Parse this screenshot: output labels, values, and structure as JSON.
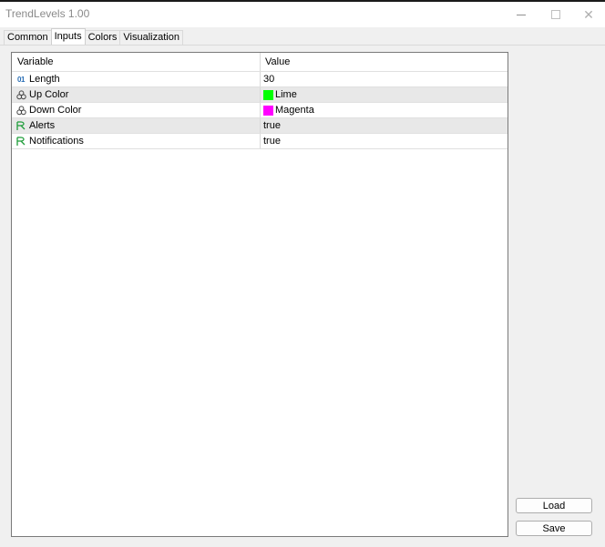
{
  "window": {
    "title": "TrendLevels 1.00"
  },
  "tabs": [
    {
      "label": "Common",
      "active": false
    },
    {
      "label": "Inputs",
      "active": true
    },
    {
      "label": "Colors",
      "active": false
    },
    {
      "label": "Visualization",
      "active": false
    }
  ],
  "grid": {
    "columns": [
      "Variable",
      "Value"
    ],
    "rows": [
      {
        "icon": "integer-icon",
        "icon_text": "01",
        "variable": "Length",
        "value": "30"
      },
      {
        "icon": "color-icon",
        "variable": "Up Color",
        "value": "Lime",
        "swatch": "#00ff00"
      },
      {
        "icon": "color-icon",
        "variable": "Down Color",
        "value": "Magenta",
        "swatch": "#ff00ff"
      },
      {
        "icon": "boolean-icon",
        "variable": "Alerts",
        "value": "true"
      },
      {
        "icon": "boolean-icon",
        "variable": "Notifications",
        "value": "true"
      }
    ]
  },
  "buttons": {
    "load_label": "Load",
    "save_label": "Save"
  },
  "colors": {
    "lime": "#00ff00",
    "magenta": "#ff00ff",
    "integer_icon": "#2a6fb5",
    "boolean_icon": "#1f9d3a"
  }
}
